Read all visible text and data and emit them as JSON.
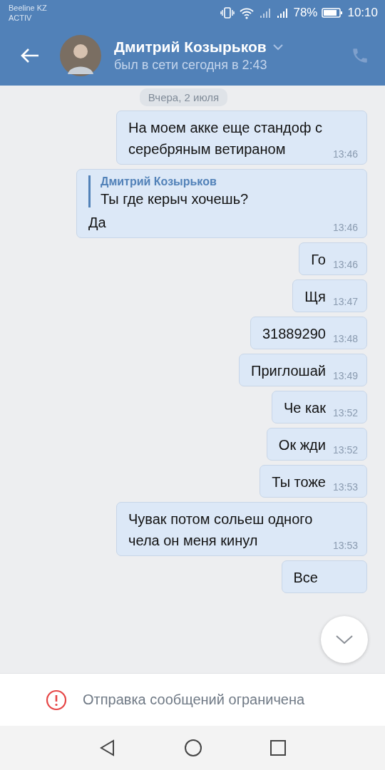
{
  "status_bar": {
    "carrier": "Beeline KZ",
    "carrier_2": "ACTIV",
    "battery": "78%",
    "time": "10:10"
  },
  "header": {
    "name": "Дмитрий Козырьков",
    "status": "был в сети сегодня в 2:43"
  },
  "date_label": "Вчера, 2 июля",
  "messages": [
    {
      "kind": "text",
      "text": "На моем акке еще стандоф с серебряным ветираном",
      "time": "13:46"
    },
    {
      "kind": "reply",
      "quote_author": "Дмитрий Козырьков",
      "quote_text": "Ты где керыч хочешь?",
      "text": "Да",
      "time": "13:46"
    },
    {
      "kind": "text",
      "text": "Го",
      "time": "13:46"
    },
    {
      "kind": "text",
      "text": "Щя",
      "time": "13:47"
    },
    {
      "kind": "text",
      "text": "31889290",
      "time": "13:48"
    },
    {
      "kind": "text",
      "text": "Приглошай",
      "time": "13:49"
    },
    {
      "kind": "text",
      "text": "Че как",
      "time": "13:52"
    },
    {
      "kind": "text",
      "text": "Ок жди",
      "time": "13:52"
    },
    {
      "kind": "text",
      "text": "Ты тоже",
      "time": "13:53"
    },
    {
      "kind": "text",
      "text": "Чувак потом сольеш одного чела он меня кинул",
      "time": "13:53"
    },
    {
      "kind": "text",
      "text": "Все"
    }
  ],
  "notice": "Отправка сообщений ограничена"
}
